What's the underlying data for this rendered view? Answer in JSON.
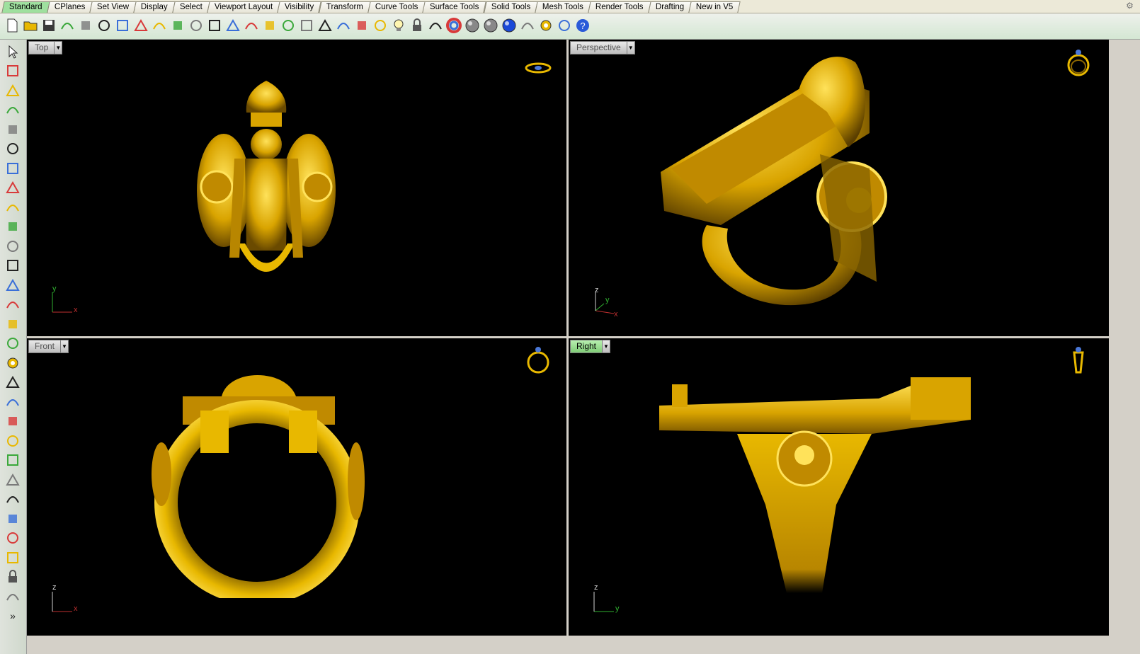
{
  "tabs": [
    "Standard",
    "CPlanes",
    "Set View",
    "Display",
    "Select",
    "Viewport Layout",
    "Visibility",
    "Transform",
    "Curve Tools",
    "Surface Tools",
    "Solid Tools",
    "Mesh Tools",
    "Render Tools",
    "Drafting",
    "New in V5"
  ],
  "active_tab": "Standard",
  "toolbar_icons": [
    "new-file-icon",
    "open-folder-icon",
    "save-icon",
    "print-icon",
    "import-icon",
    "cut-icon",
    "copy-icon",
    "paste-icon",
    "undo-icon",
    "pan-hand-icon",
    "move-view-icon",
    "zoom-icon",
    "zoom-window-icon",
    "zoom-extents-icon",
    "zoom-selected-icon",
    "rotate-view-icon",
    "four-viewports-icon",
    "car-icon",
    "grid-icon",
    "snap-icon",
    "layers-icon",
    "light-bulb-icon",
    "lock-icon",
    "material-icon",
    "color-wheel-icon",
    "shaded-sphere-icon",
    "rendered-sphere-icon",
    "blue-sphere-icon",
    "pen-icon",
    "options-gear-icon",
    "dimension-icon",
    "help-icon"
  ],
  "left_tools": [
    "select-arrow-icon",
    "point-icon",
    "polyline-icon",
    "curve-icon",
    "circle-icon",
    "ellipse-icon",
    "arc-icon",
    "rectangle-icon",
    "polygon-icon",
    "fillet-icon",
    "surface-icon",
    "extrude-icon",
    "box-icon",
    "boolean-icon",
    "cylinder-icon",
    "mesh-icon",
    "gear-analyze-icon",
    "transform-icon",
    "edit-points-icon",
    "split-icon",
    "solid-tools-icon",
    "group-icon",
    "curve-from-object-icon",
    "offset-icon",
    "text-icon",
    "dim-icon",
    "array-icon",
    "block-icon",
    "render-box-icon",
    "expand-chevron-icon"
  ],
  "viewports": {
    "top": {
      "name": "Top",
      "axis1": "x",
      "axis2": "y"
    },
    "perspective": {
      "name": "Perspective",
      "axis1": "x",
      "axis2": "y",
      "axis3": "z"
    },
    "front": {
      "name": "Front",
      "axis1": "x",
      "axis2": "z"
    },
    "right": {
      "name": "Right",
      "axis1": "y",
      "axis2": "z"
    }
  },
  "active_viewport": "Right",
  "colors": {
    "gold": "#e8b800",
    "gold_dark": "#8a6500",
    "axis_x": "#c03030",
    "axis_y": "#30b030",
    "axis_z": "#d0d0d0",
    "active_tab": "#9fe09f"
  },
  "overflow_chevron": "»"
}
